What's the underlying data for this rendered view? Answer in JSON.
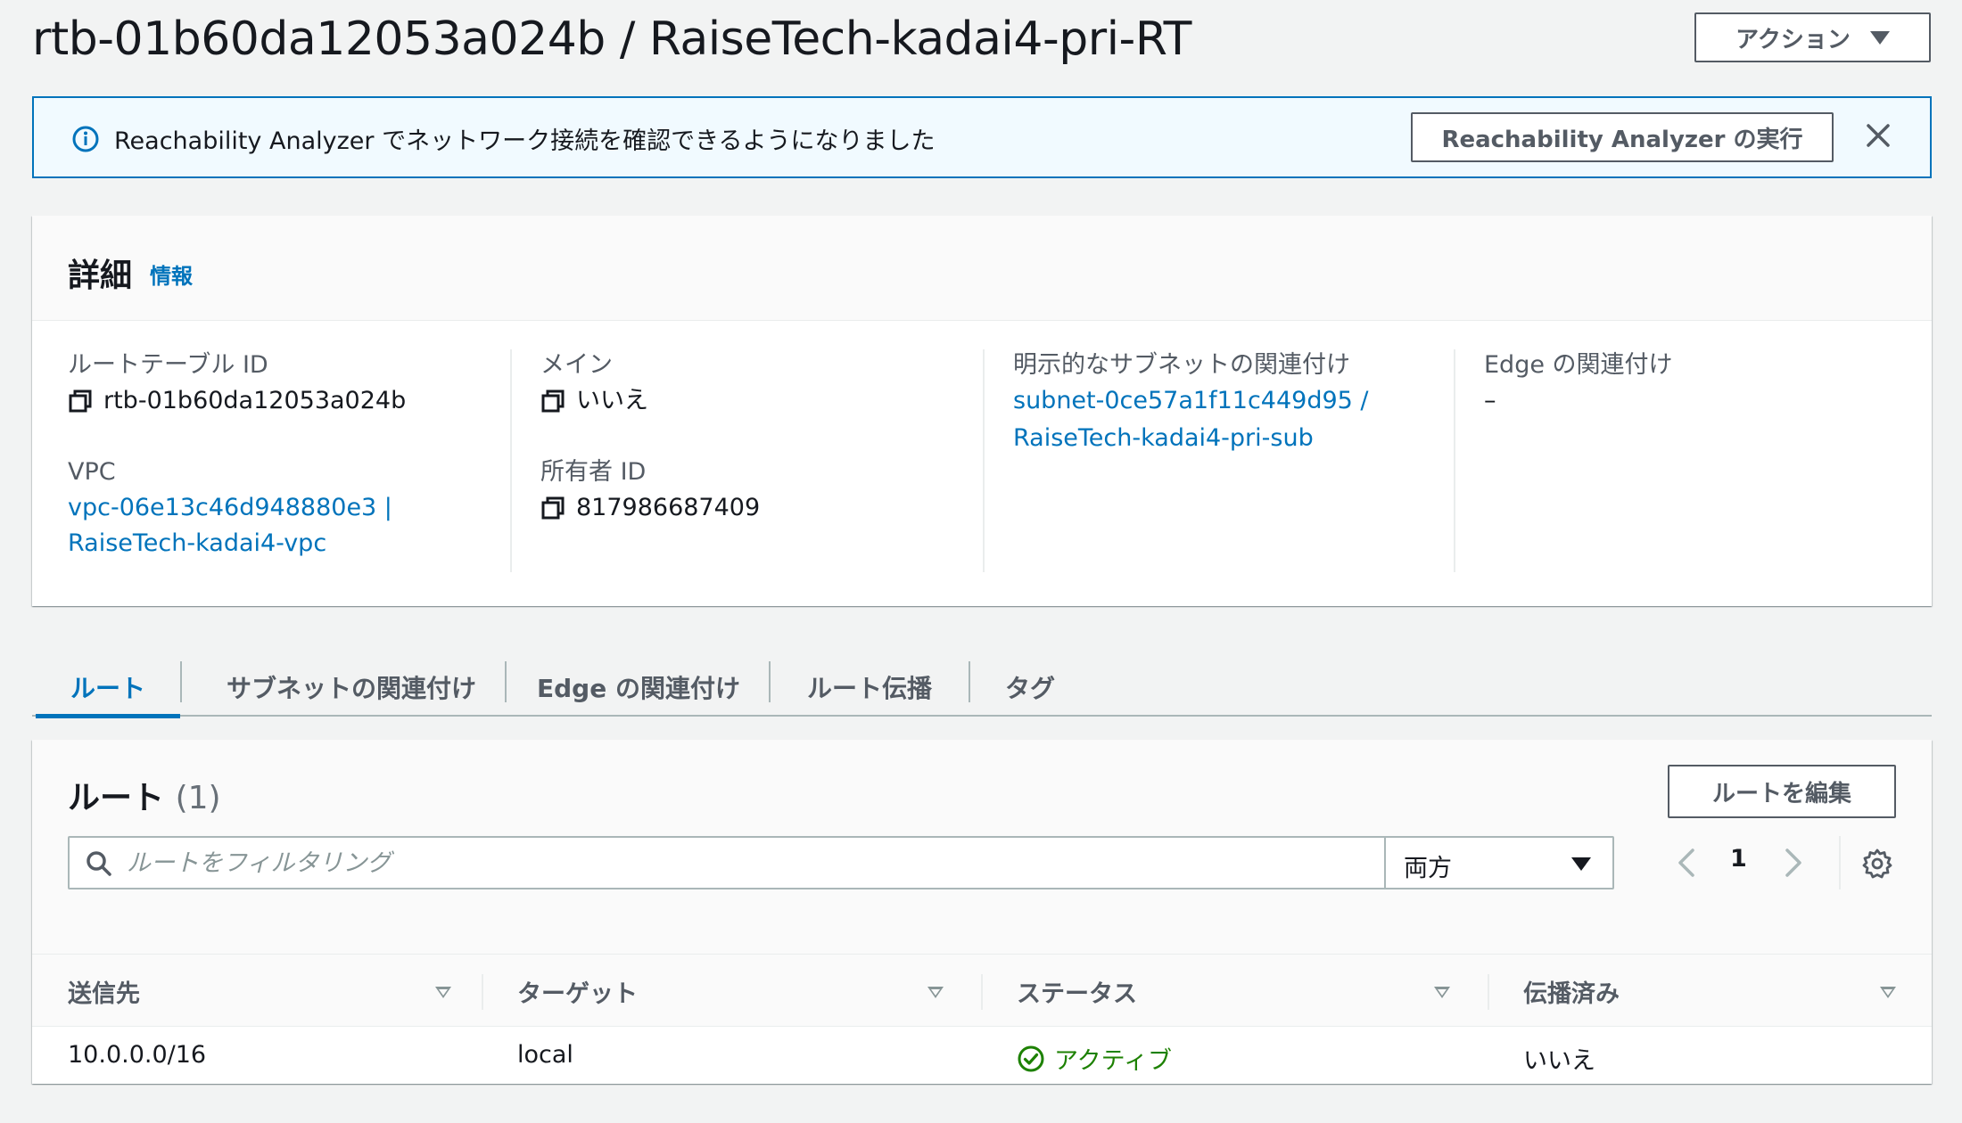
{
  "header": {
    "title": "rtb-01b60da12053a024b / RaiseTech-kadai4-pri-RT",
    "actions_label": "アクション"
  },
  "flash": {
    "message": "Reachability Analyzer でネットワーク接続を確認できるようになりました",
    "button_label": "Reachability Analyzer の実行"
  },
  "details": {
    "title": "詳細",
    "info_link": "情報",
    "route_table_id": {
      "label": "ルートテーブル ID",
      "value": "rtb-01b60da12053a024b"
    },
    "vpc": {
      "label": "VPC",
      "line1": "vpc-06e13c46d948880e3 |",
      "line2": "RaiseTech-kadai4-vpc"
    },
    "main": {
      "label": "メイン",
      "value": "いいえ"
    },
    "owner_id": {
      "label": "所有者 ID",
      "value": "817986687409"
    },
    "explicit_subnet": {
      "label": "明示的なサブネットの関連付け",
      "line1": "subnet-0ce57a1f11c449d95 /",
      "line2": "RaiseTech-kadai4-pri-sub"
    },
    "edge": {
      "label": "Edge の関連付け",
      "value": "–"
    }
  },
  "tabs": [
    {
      "label": "ルート"
    },
    {
      "label": "サブネットの関連付け"
    },
    {
      "label": "Edge の関連付け"
    },
    {
      "label": "ルート伝播"
    },
    {
      "label": "タグ"
    }
  ],
  "routes": {
    "title": "ルート",
    "count": "(1)",
    "edit_button": "ルートを編集",
    "search_placeholder": "ルートをフィルタリング",
    "filter_select": "両方",
    "page": "1",
    "columns": [
      "送信先",
      "ターゲット",
      "ステータス",
      "伝播済み"
    ],
    "rows": [
      {
        "destination": "10.0.0.0/16",
        "target": "local",
        "status": "アクティブ",
        "propagated": "いいえ"
      }
    ]
  },
  "colors": {
    "link": "#0073bb",
    "active_status": "#1d8102",
    "flash_border": "#0073bb",
    "flash_background": "#f1faff"
  },
  "icons": [
    "chevron-down-icon",
    "info-icon",
    "close-icon",
    "copy-icon",
    "search-icon",
    "chevron-left-icon",
    "chevron-right-icon",
    "settings-icon",
    "sort-caret-icon",
    "status-check-icon"
  ]
}
